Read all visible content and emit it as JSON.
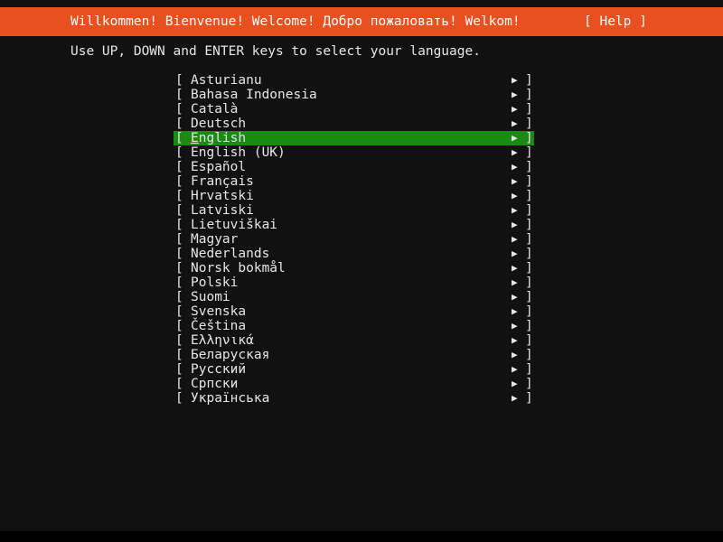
{
  "header": {
    "greeting": "Willkommen! Bienvenue! Welcome! Добро пожаловать! Welkom!",
    "help_label": "[ Help ]",
    "background_color": "#e8511f",
    "text_color": "#ffffff"
  },
  "instruction": {
    "text": "Use UP, DOWN and ENTER keys to select your language."
  },
  "list": {
    "bracket_open": "[",
    "bracket_close": "]",
    "arrow_glyph": "▶",
    "selected_index": 4,
    "selection_background_color": "#1a8a15",
    "items": [
      {
        "label": "Asturianu"
      },
      {
        "label": "Bahasa Indonesia"
      },
      {
        "label": "Català"
      },
      {
        "label": "Deutsch"
      },
      {
        "label": "English",
        "accel": "E",
        "rest": "nglish"
      },
      {
        "label": "English (UK)"
      },
      {
        "label": "Español"
      },
      {
        "label": "Français"
      },
      {
        "label": "Hrvatski"
      },
      {
        "label": "Latviski"
      },
      {
        "label": "Lietuviškai"
      },
      {
        "label": "Magyar"
      },
      {
        "label": "Nederlands"
      },
      {
        "label": "Norsk bokmål"
      },
      {
        "label": "Polski"
      },
      {
        "label": "Suomi"
      },
      {
        "label": "Svenska"
      },
      {
        "label": "Čeština"
      },
      {
        "label": "Ελληνικά"
      },
      {
        "label": "Беларуская"
      },
      {
        "label": "Русский"
      },
      {
        "label": "Српски"
      },
      {
        "label": "Українська"
      }
    ]
  },
  "theme": {
    "console_background": "#111111",
    "screen_background": "#000000",
    "foreground": "#e6e6e6"
  }
}
